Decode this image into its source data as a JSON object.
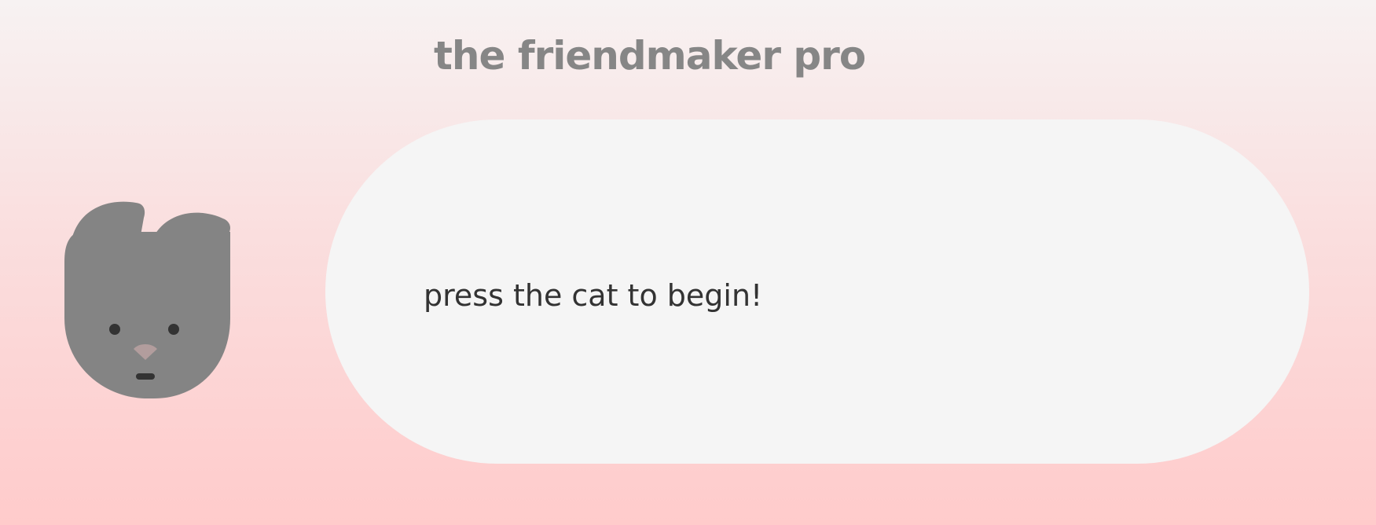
{
  "app": {
    "title": "the friendmaker pro"
  },
  "cat": {
    "icon": "cat-face-icon",
    "colors": {
      "fur": "#848484",
      "eyes": "#333333",
      "nose": "#b29d9d",
      "mouth": "#333333"
    }
  },
  "bubble": {
    "text": "press the cat to begin!",
    "background": "#f5f5f5"
  },
  "theme": {
    "background_top": "#f7f2f2",
    "background_bottom": "#ffcbcb",
    "title_color": "#868686",
    "text_color": "#333333"
  }
}
